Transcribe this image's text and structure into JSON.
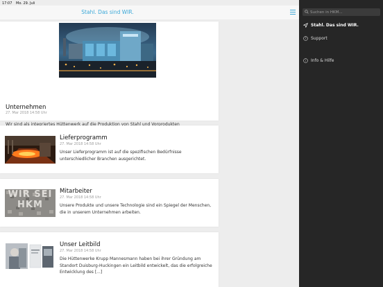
{
  "status": {
    "time": "17:07",
    "date": "Mo. 29. Juli"
  },
  "navbar": {
    "title": "Stahl. Das sind WIR."
  },
  "cards": [
    {
      "title": "Unternehmen",
      "date": "27. Mar 2018 14:58 Uhr",
      "text": "Wir sind als integriertes Hüttenwerk auf die Produktion von Stahl und Vorprodukten für die verarbeitende Industrie spezialisiert."
    },
    {
      "title": "Lieferprogramm",
      "date": "27. Mar 2018 14:58 Uhr",
      "text": "Unser Lieferprogramm ist auf die spezifischen Bedürfnisse unterschiedlicher Branchen ausgerichtet."
    },
    {
      "title": "Mitarbeiter",
      "date": "27. Mar 2018 14:58 Uhr",
      "text": "Unsere Produkte und unsere Technologie sind ein Spiegel der Menschen, die in unserem Unternehmen arbeiten.",
      "image_text": "WIR SEI HKM"
    },
    {
      "title": "Unser Leitbild",
      "date": "27. Mar 2018 14:58 Uhr",
      "text": "Die Hüttenwerke Krupp Mannesmann haben bei ihrer Gründung am Standort Duisburg-Huckingen ein Leitbild entwickelt, das die erfolgreiche Entwicklung des [...]"
    }
  ],
  "sidebar": {
    "search_placeholder": "Suchen in HKM...",
    "items": [
      {
        "label": "Stahl. Das sind WIR.",
        "icon": "navigation-arrow-icon",
        "active": true
      },
      {
        "label": "Support",
        "icon": "help-circle-icon",
        "active": false
      },
      {
        "label": "Info & Hilfe",
        "icon": "info-circle-icon",
        "active": false
      }
    ]
  },
  "colors": {
    "accent": "#3aa8d8",
    "sidebar_bg": "#262626",
    "page_bg": "#ededed"
  }
}
